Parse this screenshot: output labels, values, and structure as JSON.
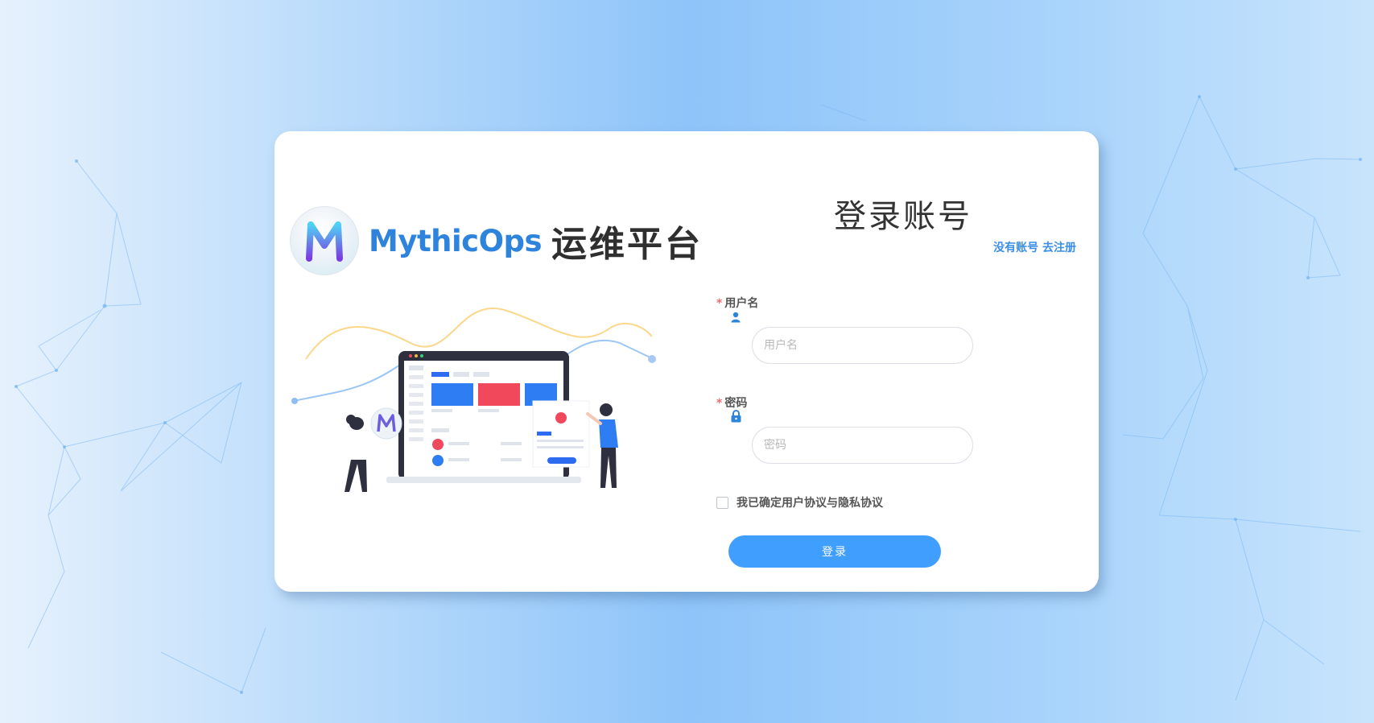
{
  "brand": {
    "name": "MythicOps",
    "title": "运维平台",
    "logo_letter": "M"
  },
  "login": {
    "title": "登录账号",
    "register_link": "没有账号 去注册",
    "username": {
      "label": "用户名",
      "placeholder": "用户名",
      "value": "",
      "icon": "user-icon"
    },
    "password": {
      "label": "密码",
      "placeholder": "密码",
      "value": "",
      "icon": "lock-icon"
    },
    "required_mark": "*",
    "agreement": {
      "text": "我已确定用户协议与隐私协议",
      "checked": false
    },
    "submit_label": "登录"
  },
  "colors": {
    "brand_blue": "#2e84dd",
    "primary": "#409eff",
    "required": "#f56c6c",
    "card_bg": "#ffffff"
  }
}
